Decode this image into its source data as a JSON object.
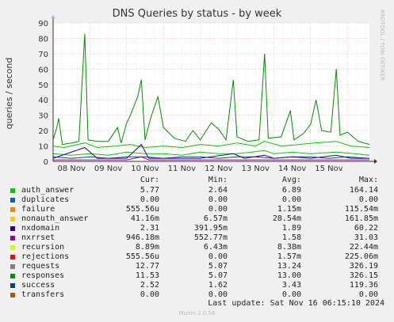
{
  "title": "DNS Queries by status - by week",
  "side_text": "RRDTOOL / TOBI OETIKER",
  "footer": "Munin 2.0.56",
  "last_update": "Last update: Sat Nov 16 06:15:10 2024",
  "legend_headers": [
    "Cur:",
    "Min:",
    "Avg:",
    "Max:"
  ],
  "legend": [
    {
      "name": "auth_answer",
      "color": "#00cc00",
      "cur": "5.77",
      "min": "2.64",
      "avg": "6.89",
      "max": "164.14"
    },
    {
      "name": "duplicates",
      "color": "#0066b3",
      "cur": "0.00",
      "min": "0.00",
      "avg": "0.00",
      "max": "0.00"
    },
    {
      "name": "failure",
      "color": "#ff8000",
      "cur": "555.56u",
      "min": "0.00",
      "avg": "1.15m",
      "max": "115.54m"
    },
    {
      "name": "nonauth_answer",
      "color": "#ffcc00",
      "cur": "41.16m",
      "min": "6.57m",
      "avg": "28.54m",
      "max": "161.85m"
    },
    {
      "name": "nxdomain",
      "color": "#330099",
      "cur": "2.31",
      "min": "391.95m",
      "avg": "1.89",
      "max": "60.22"
    },
    {
      "name": "nxrrset",
      "color": "#990099",
      "cur": "946.18m",
      "min": "552.77m",
      "avg": "1.58",
      "max": "31.03"
    },
    {
      "name": "recursion",
      "color": "#ccff00",
      "cur": "8.89m",
      "min": "6.43m",
      "avg": "8.38m",
      "max": "22.44m"
    },
    {
      "name": "rejections",
      "color": "#ff0000",
      "cur": "555.56u",
      "min": "0.00",
      "avg": "1.57m",
      "max": "225.06m"
    },
    {
      "name": "requests",
      "color": "#808080",
      "cur": "12.77",
      "min": "5.07",
      "avg": "13.24",
      "max": "326.19"
    },
    {
      "name": "responses",
      "color": "#008f00",
      "cur": "11.53",
      "min": "5.07",
      "avg": "13.00",
      "max": "326.15"
    },
    {
      "name": "success",
      "color": "#00487d",
      "cur": "2.52",
      "min": "1.62",
      "avg": "3.43",
      "max": "119.36"
    },
    {
      "name": "transfers",
      "color": "#b35a00",
      "cur": "0.00",
      "min": "0.00",
      "avg": "0.00",
      "max": "0.00"
    }
  ],
  "chart_data": {
    "type": "line",
    "title": "DNS Queries by status - by week",
    "ylabel": "queries / second",
    "xlabel": "",
    "ylim": [
      0,
      90
    ],
    "yticks": [
      0,
      10,
      20,
      30,
      40,
      50,
      60,
      70,
      80,
      90
    ],
    "categories": [
      "08 Nov",
      "09 Nov",
      "10 Nov",
      "11 Nov",
      "12 Nov",
      "13 Nov",
      "14 Nov",
      "15 Nov"
    ],
    "x_range_days": [
      0,
      8.6
    ],
    "grid": true,
    "series": [
      {
        "name": "responses",
        "color": "#008f00",
        "points": [
          [
            0,
            14
          ],
          [
            0.1,
            22
          ],
          [
            0.15,
            28
          ],
          [
            0.25,
            11
          ],
          [
            0.5,
            12
          ],
          [
            0.7,
            13
          ],
          [
            0.86,
            83
          ],
          [
            0.95,
            14
          ],
          [
            1.2,
            13
          ],
          [
            1.5,
            13
          ],
          [
            1.75,
            22
          ],
          [
            1.85,
            12
          ],
          [
            2.0,
            25
          ],
          [
            2.1,
            30
          ],
          [
            2.3,
            42
          ],
          [
            2.4,
            53
          ],
          [
            2.5,
            14
          ],
          [
            2.65,
            28
          ],
          [
            2.85,
            42
          ],
          [
            3.0,
            22
          ],
          [
            3.3,
            15
          ],
          [
            3.6,
            13
          ],
          [
            3.8,
            20
          ],
          [
            4.0,
            14
          ],
          [
            4.3,
            25
          ],
          [
            4.5,
            21
          ],
          [
            4.7,
            14
          ],
          [
            4.9,
            53
          ],
          [
            5.0,
            16
          ],
          [
            5.3,
            13
          ],
          [
            5.6,
            14
          ],
          [
            5.75,
            70
          ],
          [
            5.85,
            15
          ],
          [
            6.2,
            16
          ],
          [
            6.45,
            33
          ],
          [
            6.55,
            14
          ],
          [
            6.8,
            18
          ],
          [
            7.0,
            24
          ],
          [
            7.15,
            40
          ],
          [
            7.3,
            20
          ],
          [
            7.55,
            19
          ],
          [
            7.7,
            60
          ],
          [
            7.8,
            17
          ],
          [
            8.0,
            19
          ],
          [
            8.3,
            13
          ],
          [
            8.6,
            11
          ]
        ]
      },
      {
        "name": "requests",
        "color": "#00cc00",
        "points": [
          [
            0,
            10
          ],
          [
            0.3,
            9
          ],
          [
            0.86,
            12
          ],
          [
            1.2,
            9
          ],
          [
            1.7,
            10
          ],
          [
            2.1,
            11
          ],
          [
            2.5,
            9
          ],
          [
            3.0,
            10
          ],
          [
            3.5,
            9
          ],
          [
            4.0,
            11
          ],
          [
            4.5,
            10
          ],
          [
            5.0,
            12
          ],
          [
            5.5,
            10
          ],
          [
            5.75,
            13
          ],
          [
            6.2,
            10
          ],
          [
            6.7,
            11
          ],
          [
            7.1,
            12
          ],
          [
            7.7,
            13
          ],
          [
            8.1,
            10
          ],
          [
            8.6,
            9
          ]
        ]
      },
      {
        "name": "auth_answer",
        "color": "#00cc00",
        "points": [
          [
            0,
            5
          ],
          [
            0.5,
            4
          ],
          [
            1.0,
            5
          ],
          [
            1.5,
            4
          ],
          [
            2.0,
            6
          ],
          [
            2.5,
            5
          ],
          [
            3.0,
            5
          ],
          [
            3.5,
            4
          ],
          [
            4.0,
            6
          ],
          [
            4.5,
            5
          ],
          [
            5.0,
            5
          ],
          [
            5.75,
            7
          ],
          [
            6.0,
            5
          ],
          [
            6.5,
            6
          ],
          [
            7.0,
            5
          ],
          [
            7.7,
            6
          ],
          [
            8.2,
            5
          ],
          [
            8.6,
            4
          ]
        ]
      },
      {
        "name": "success",
        "color": "#00487d",
        "points": [
          [
            0,
            3
          ],
          [
            0.5,
            2
          ],
          [
            1.0,
            3
          ],
          [
            1.5,
            2
          ],
          [
            2.0,
            3
          ],
          [
            2.5,
            3
          ],
          [
            3.0,
            2
          ],
          [
            3.5,
            3
          ],
          [
            4.0,
            3
          ],
          [
            4.5,
            2
          ],
          [
            5.0,
            3
          ],
          [
            5.5,
            3
          ],
          [
            6.0,
            2
          ],
          [
            6.5,
            3
          ],
          [
            7.0,
            3
          ],
          [
            7.5,
            2
          ],
          [
            8.0,
            3
          ],
          [
            8.6,
            2
          ]
        ]
      },
      {
        "name": "nxdomain",
        "color": "#330099",
        "points": [
          [
            0,
            2
          ],
          [
            0.86,
            9
          ],
          [
            1.2,
            2
          ],
          [
            2.0,
            2
          ],
          [
            2.4,
            11
          ],
          [
            2.6,
            2
          ],
          [
            3.5,
            2
          ],
          [
            4.0,
            2
          ],
          [
            4.9,
            5
          ],
          [
            5.2,
            2
          ],
          [
            5.75,
            4
          ],
          [
            6.0,
            2
          ],
          [
            6.5,
            3
          ],
          [
            7.0,
            2
          ],
          [
            7.7,
            4
          ],
          [
            8.1,
            2
          ],
          [
            8.6,
            2
          ]
        ]
      },
      {
        "name": "nxrrset",
        "color": "#990099",
        "points": [
          [
            0,
            1
          ],
          [
            1.0,
            1
          ],
          [
            2.0,
            1
          ],
          [
            2.4,
            3
          ],
          [
            2.6,
            1
          ],
          [
            3.5,
            1
          ],
          [
            4.5,
            1
          ],
          [
            5.5,
            1
          ],
          [
            6.5,
            1
          ],
          [
            7.5,
            1
          ],
          [
            8.6,
            1
          ]
        ]
      }
    ]
  }
}
